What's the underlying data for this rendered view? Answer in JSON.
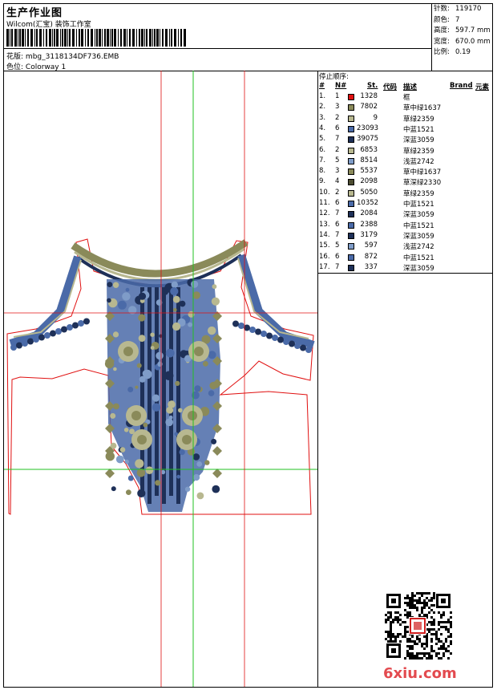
{
  "header": {
    "title": "生产作业图",
    "subtitle": "Wilcom(汇宝) 装饰工作室",
    "design_label": "花版:",
    "design_value": "mbg_3118134DF736.EMB",
    "colorway_label": "色位:",
    "colorway_value": "Colorway 1"
  },
  "stats": [
    {
      "label": "针数:",
      "value": "119170"
    },
    {
      "label": "颜色:",
      "value": "7"
    },
    {
      "label": "高度:",
      "value": "597.7 mm"
    },
    {
      "label": "宽度:",
      "value": "670.0 mm"
    },
    {
      "label": "比例:",
      "value": "0.19"
    }
  ],
  "stop_sequence": {
    "title": "停止顺序:",
    "headers": {
      "hash": "#",
      "n": "N#",
      "st": "St.",
      "code": "代码",
      "desc": "描述",
      "brand": "Brand",
      "extra": "元素"
    },
    "rows": [
      {
        "num": "1.",
        "n": "1",
        "color": "#e01010",
        "st": "1328",
        "desc": "框"
      },
      {
        "num": "2.",
        "n": "3",
        "color": "#8a8a5a",
        "st": "7802",
        "desc": "草中绿1637"
      },
      {
        "num": "3.",
        "n": "2",
        "color": "#b8b890",
        "st": "9",
        "desc": "草绿2359"
      },
      {
        "num": "4.",
        "n": "6",
        "color": "#4a6aa8",
        "st": "23093",
        "desc": "中蓝1521"
      },
      {
        "num": "5.",
        "n": "7",
        "color": "#1e3058",
        "st": "39075",
        "desc": "深蓝3059"
      },
      {
        "num": "6.",
        "n": "2",
        "color": "#b8b890",
        "st": "6853",
        "desc": "草绿2359"
      },
      {
        "num": "7.",
        "n": "5",
        "color": "#7f9cc8",
        "st": "8514",
        "desc": "浅蓝2742"
      },
      {
        "num": "8.",
        "n": "3",
        "color": "#8a8a5a",
        "st": "5537",
        "desc": "草中绿1637"
      },
      {
        "num": "9.",
        "n": "4",
        "color": "#4c4c30",
        "st": "2098",
        "desc": "草深绿2330"
      },
      {
        "num": "10.",
        "n": "2",
        "color": "#b8b890",
        "st": "5050",
        "desc": "草绿2359"
      },
      {
        "num": "11.",
        "n": "6",
        "color": "#4a6aa8",
        "st": "10352",
        "desc": "中蓝1521"
      },
      {
        "num": "12.",
        "n": "7",
        "color": "#1e3058",
        "st": "2084",
        "desc": "深蓝3059"
      },
      {
        "num": "13.",
        "n": "6",
        "color": "#4a6aa8",
        "st": "2388",
        "desc": "中蓝1521"
      },
      {
        "num": "14.",
        "n": "7",
        "color": "#1e3058",
        "st": "3179",
        "desc": "深蓝3059"
      },
      {
        "num": "15.",
        "n": "5",
        "color": "#7f9cc8",
        "st": "597",
        "desc": "浅蓝2742"
      },
      {
        "num": "16.",
        "n": "6",
        "color": "#4a6aa8",
        "st": "872",
        "desc": "中蓝1521"
      },
      {
        "num": "17.",
        "n": "7",
        "color": "#1e3058",
        "st": "337",
        "desc": "深蓝3059"
      }
    ]
  },
  "watermark": {
    "text": "6xiu.com",
    "color": "#e34a4f"
  },
  "icons": {
    "qr": "qr-code-icon",
    "seal": "red-seal-icon",
    "barcode": "barcode-icon"
  },
  "colors": {
    "frame_outline": "#e01010",
    "guide_green": "#22c022",
    "guide_red": "#e01010"
  }
}
